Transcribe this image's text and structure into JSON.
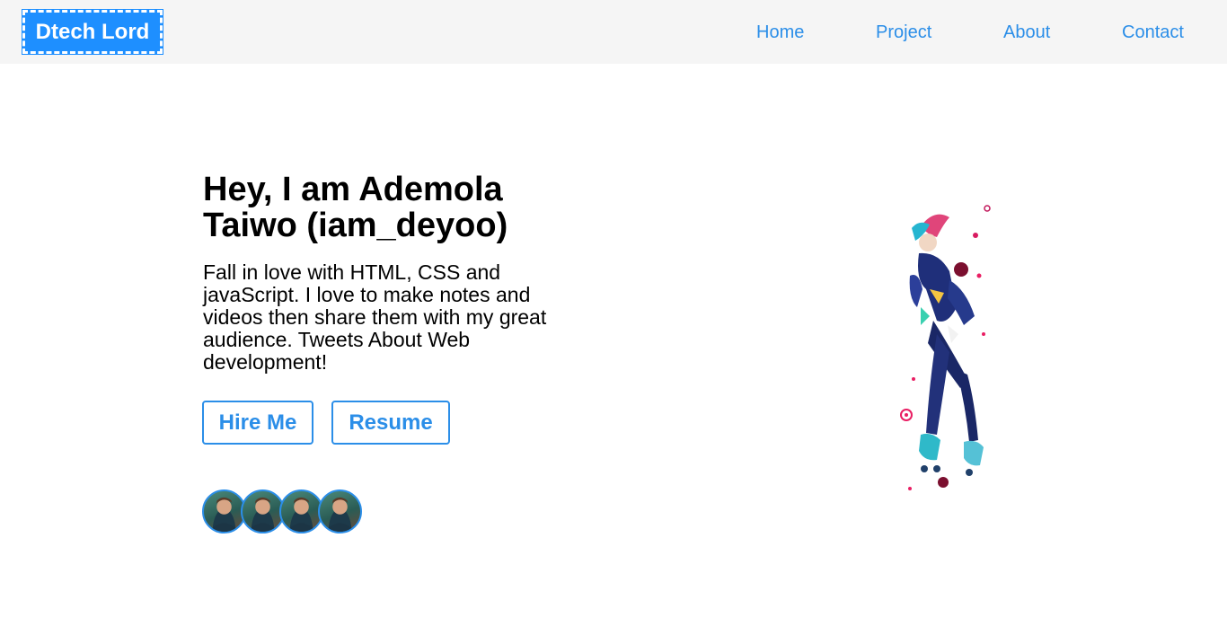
{
  "nav": {
    "logo": "Dtech Lord",
    "links": [
      "Home",
      "Project",
      "About",
      "Contact"
    ]
  },
  "hero": {
    "title": "Hey, I am Ademola Taiwo (iam_deyoo)",
    "description": "Fall in love with HTML, CSS and javaScript. I love to make notes and videos then share them with my great audience. Tweets About Web development!",
    "buttons": {
      "hire": "Hire Me",
      "resume": "Resume"
    },
    "avatar_icons": [
      "avatar-icon",
      "avatar-icon",
      "avatar-icon",
      "avatar-icon"
    ]
  },
  "colors": {
    "accent": "#2b8ee8",
    "logo_bg": "#1e8fff",
    "navbar_bg": "#f5f5f5",
    "text": "#000000"
  },
  "icons": {
    "illustration": "skateboarder-illustration"
  }
}
